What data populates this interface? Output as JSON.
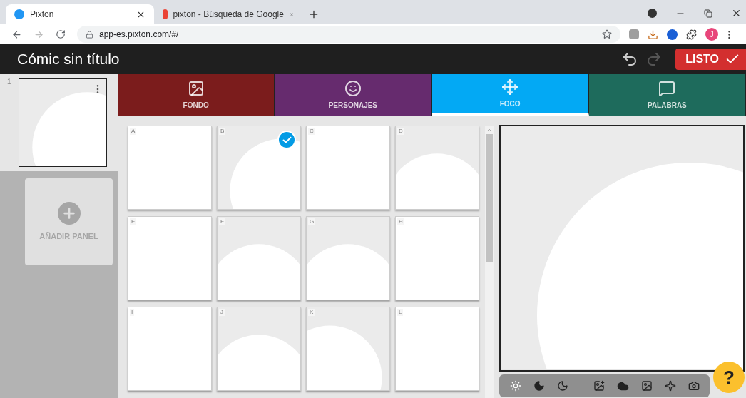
{
  "browser": {
    "tabs": [
      {
        "title": "Pixton",
        "selected": true
      },
      {
        "title": "pixton - Búsqueda de Google",
        "selected": false
      }
    ],
    "url": "app-es.pixton.com/#/",
    "profile": "J"
  },
  "app": {
    "title": "Cómic sin título",
    "done_button": "LISTO"
  },
  "panels": [
    {
      "number": "1",
      "selected": true
    }
  ],
  "add_panel": "AÑADIR PANEL",
  "tabs": [
    {
      "label": "FONDO",
      "kind": "background",
      "color": "#7b1c1c",
      "selected": false
    },
    {
      "label": "PERSONAJES",
      "kind": "characters",
      "color": "#662b6e",
      "selected": false
    },
    {
      "label": "FOCO",
      "kind": "focus",
      "color": "#03a9f4",
      "selected": true
    },
    {
      "label": "PALABRAS",
      "kind": "words",
      "color": "#1e6b5c",
      "selected": false
    }
  ],
  "layouts": [
    {
      "letter": "A",
      "kind": "plain",
      "selected": false
    },
    {
      "letter": "B",
      "kind": "circle-right",
      "selected": true
    },
    {
      "letter": "C",
      "kind": "plain",
      "selected": false
    },
    {
      "letter": "D",
      "kind": "arch",
      "selected": false
    },
    {
      "letter": "E",
      "kind": "plain",
      "selected": false
    },
    {
      "letter": "F",
      "kind": "arch",
      "selected": false
    },
    {
      "letter": "G",
      "kind": "arch",
      "selected": false
    },
    {
      "letter": "H",
      "kind": "plain",
      "selected": false
    },
    {
      "letter": "I",
      "kind": "plain",
      "selected": false
    },
    {
      "letter": "J",
      "kind": "arch",
      "selected": false
    },
    {
      "letter": "K",
      "kind": "circle-left",
      "selected": false
    },
    {
      "letter": "L",
      "kind": "plain",
      "selected": false
    }
  ],
  "help_button": "?"
}
